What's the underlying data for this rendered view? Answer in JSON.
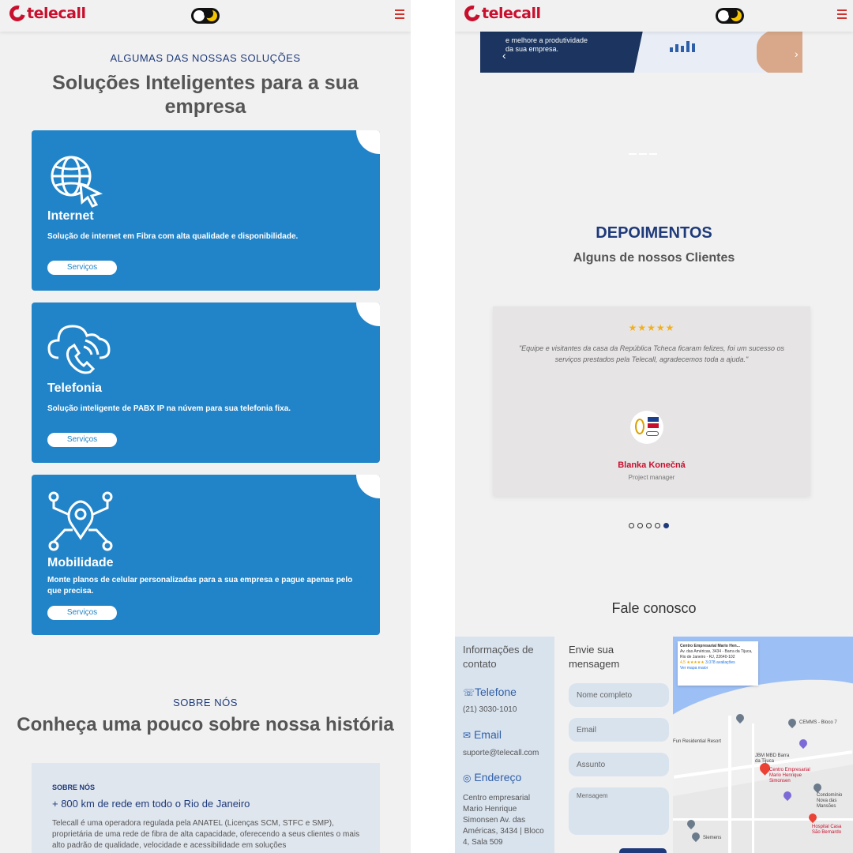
{
  "brand": {
    "name": "telecall",
    "color": "#c8102e"
  },
  "colors": {
    "primary": "#2284c8",
    "navy": "#1e3a7a",
    "accent_red": "#c8102e"
  },
  "left": {
    "eyebrow": "ALGUMAS DAS NOSSAS SOLUÇÕES",
    "heading": "Soluções Inteligentes para a sua empresa",
    "cards": [
      {
        "icon": "globe-cursor-icon",
        "title": "Internet",
        "desc": "Solução de internet em Fibra com alta qualidade e disponibilidade.",
        "button": "Serviços"
      },
      {
        "icon": "cloud-phone-icon",
        "title": "Telefonia",
        "desc": "Solução inteligente de PABX IP na núvem para sua telefonia fixa.",
        "button": "Serviços"
      },
      {
        "icon": "location-network-icon",
        "title": "Mobilidade",
        "desc": "Monte planos de celular personalizadas para a sua empresa e pague apenas pelo que precisa.",
        "button": "Serviços"
      }
    ],
    "about_eyebrow": "SOBRE NÓS",
    "about_heading": "Conheça uma pouco sobre nossa história",
    "about_card": {
      "label": "SOBRE NÓS",
      "headline": "+ 800 km de rede em todo o Rio de Janeiro",
      "body": "Telecall é uma operadora regulada pela ANATEL (Licenças SCM, STFC e SMP), proprietária de uma rede de fibra de alta capacidade, oferecendo a seus clientes o mais alto padrão de qualidade, velocidade e acessibilidade em soluções"
    }
  },
  "right": {
    "banner_text": "e melhore a produtividade\nda sua empresa.",
    "testimonials_title": "DEPOIMENTOS",
    "testimonials_subtitle": "Alguns de nossos Clientes",
    "testimonial": {
      "stars": "★★★★★",
      "quote": "\"Equipe e visitantes da casa da República Tcheca ficaram felizes, foi um sucesso os serviços prestados pela Telecall, agradecemos toda a ajuda.\"",
      "name": "Blanka Konečná",
      "role": "Project manager"
    },
    "carousel": {
      "total": 5,
      "active_index": 4
    },
    "contact_title": "Fale conosco",
    "info": {
      "title": "Informações de contato",
      "phone_label": "Telefone",
      "phone": "(21) 3030-1010",
      "email_label": "Email",
      "email": "suporte@telecall.com",
      "address_label": "Endereço",
      "address": "Centro empresarial Mario Henrique Simonsen Av. das Américas, 3434 | Bloco 4, Sala 509"
    },
    "form": {
      "title": "Envie sua mensagem",
      "name_placeholder": "Nome completo",
      "email_placeholder": "Email",
      "subject_placeholder": "Assunto",
      "message_placeholder": "Mensagem"
    },
    "map": {
      "place": "Centro Empresarial Mario Hen...",
      "address": "Av. das Américas, 3434 - Barra da Tijuca, Rio de Janeiro - RJ, 22640-102",
      "rating": "4,5 ★★★★★",
      "reviews": "3.078 avaliações",
      "larger_map": "Ver mapa maior",
      "labels": [
        "CEMMS - Bloco 7",
        "Fun Residential Resort",
        "JBM MBD Barra da Tijuca",
        "Centro Empresarial Mario Henrique Simonsen",
        "Condomínio Nova das Mansões",
        "Hospital Casa São Bernardo",
        "Siemens"
      ]
    }
  }
}
